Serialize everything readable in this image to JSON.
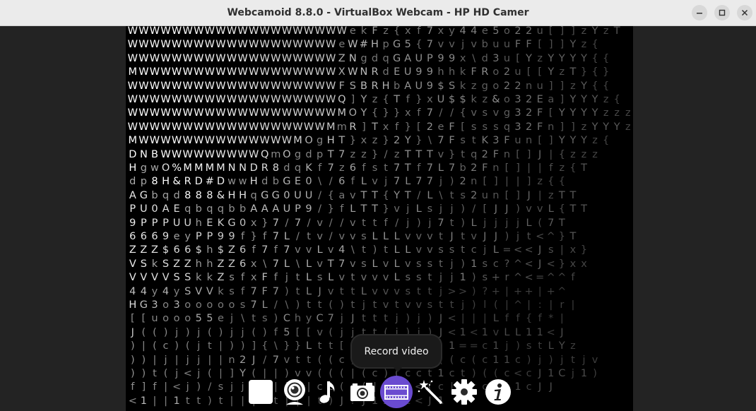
{
  "window": {
    "title": "Webcamoid 8.8.0 - VirtualBox Webcam - HP HD Camer",
    "buttons": [
      "minimize-icon",
      "maximize-icon",
      "close-icon"
    ]
  },
  "viewport": {
    "ascii_rows": [
      "WWWWWWWWWWWWWWWWWWWWekFz{xf7xy44e5o22u[]]zYzT",
      "WWWWWWWWWWWWWWWWWWWeW#HpG5{7vvjvbuuFF[]]Yz{",
      "WWWWWWWWWWWWWWWWWWWZNgdqGAUP99x\\d3u[YzYYYY{{",
      "MWWWWWWWWWWWWWWWWWWXWNRdEU99hhkFRo2u[[YzT}{}",
      "WWWWWWWWWWWWWWWWWWWFSBRHbAU9$Skzgo22nu]]zY{{",
      "WWWWWWWWWWWWWWWWWWWQ]Yz{Tf}xU$$kz&o32Ea]YYYz{",
      "WWWWWWWWWWWWWWWWWWWMOY{}}xf7//{vsvg32F[YYYYzzz",
      "WWWWWWWWWWWWWWWWWWMmR]Txf}[2eF[sssq32Fn]]zYYYz",
      "MWWWWWWWWWWWWWWMOgHT}xz}2Y}\\7FstK3Fun[]YYYz{",
      "DNBWWWWWWWWWQmOgdpT7zz}/zTTTv}tq2Fn[]J|{zzz",
      "HgwO%MMMMNNDR8dqKf7z6fst7Tf7L7b2Fn[]||fz{T",
      "dp8H&RD#DwwHdbGE0\\/6fLvj7L77j)2n[]||]z{{",
      "AGbqd888&HHqGG0UU/{avTT{YT/L\\ts2un[]J|zTT",
      "PU0AEqbqqbbAAAUP9/}fLTT}vjLsjj)/[JJ)vvL{TT",
      "9PPPUUhEKG0x}7/7/v//vttf/j)j7t)LjjjjL(7T",
      "6669eyPP99f}f7L/tv/vvsLLLvvvtJtvJJ)jt<^}T",
      "ZZZ$66$h$Z6f7f7vvLv4\\t)tLLvvsstcjL=<<Js|x}",
      "VSkSZZhhZZ6x\\7L\\LvT7vsLvLvsstj)1sc?^<J<}xx",
      "VVVVSSkkZsfxFfjtLsLvtvvvLsstjj1)s+r^<=^^f",
      "44y4ySVVksf7F7)tLJvttLvvvsttj>>)?+|++|+^",
      "HG3o3ooooos7L/\\)tt()tjtvtvvsttj)l(|^|:|r|",
      "[[uooo55ej\\ts)ChyC7jJtttj)j)J<|||Lff{f*|",
      "J(()j)j()jj()f5[[v(jjtt(j)j)J<1<1vLL11<J",
      ")|(c)(jt|))]{\\}}Ltt[[j1]((j)J1==c1j)stLYz",
      "))|j|jj||n2J/7vtt((c)vc)j)j(((c(c11c)j)jtjv",
      "))t(j<j(|]Y(||)vv(((|(c)(cct1ct)((c<cJ1Cj1)",
      "f]f|<j)/sjj)J|jj|cc(c(|c|c<(c|(ccJ|1cJJ",
      "<1||1tt)t|||tt|||t)J?J11|c<J1"
    ]
  },
  "tooltip": {
    "label": "Record video"
  },
  "toolbar": {
    "items": [
      {
        "name": "preview-icon",
        "active": false
      },
      {
        "name": "webcam-icon",
        "active": false
      },
      {
        "name": "audio-icon",
        "active": false
      },
      {
        "name": "camera-icon",
        "active": false
      },
      {
        "name": "video-record-icon",
        "active": true
      },
      {
        "name": "effects-wand-icon",
        "active": false
      },
      {
        "name": "settings-gear-icon",
        "active": false
      },
      {
        "name": "info-icon",
        "active": false
      }
    ],
    "accent_color": "#6a4bd0"
  }
}
